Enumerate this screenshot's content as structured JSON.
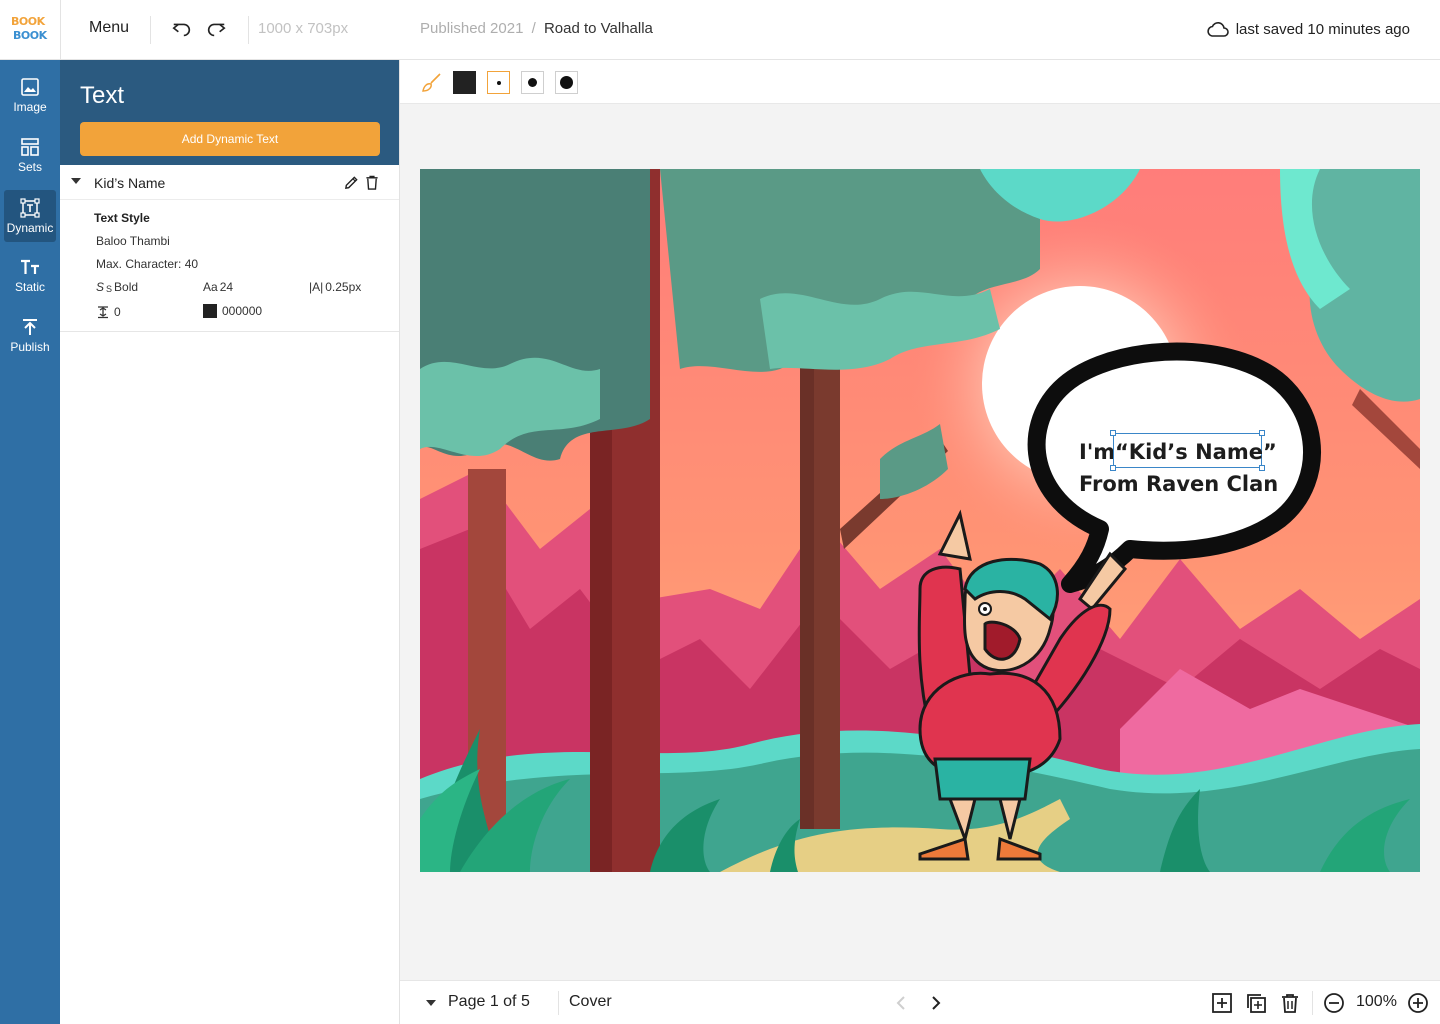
{
  "app": {
    "logo_top": "BOOK",
    "logo_bottom": "BOOK"
  },
  "topbar": {
    "menu_label": "Menu",
    "canvas_size": "1000 x 703px",
    "breadcrumb": {
      "parent": "Published 2021",
      "separator": "/",
      "current": "Road to Valhalla"
    },
    "save_status": "last saved 10 minutes ago"
  },
  "rail": {
    "items": [
      {
        "label": "Image",
        "icon": "image-icon"
      },
      {
        "label": "Sets",
        "icon": "sets-icon"
      },
      {
        "label": "Dynamic",
        "icon": "dynamic-text-icon",
        "active": true
      },
      {
        "label": "Static",
        "icon": "static-text-icon"
      },
      {
        "label": "Publish",
        "icon": "publish-icon"
      }
    ]
  },
  "panel": {
    "title": "Text",
    "add_button": "Add Dynamic Text",
    "item": {
      "name": "Kid’s Name",
      "style_title": "Text Style",
      "font": "Baloo Thambi",
      "max_chars": "Max. Character: 40",
      "weight": "Bold",
      "size": "24",
      "letter_spacing": "0.25px",
      "line_height": "0",
      "color_hex": "000000",
      "weight_icon": "S",
      "size_icon": "Aa",
      "spacing_icon": "|A|"
    }
  },
  "toolbar": {
    "tools": [
      "brush-icon",
      "color-swatch",
      "dot-small",
      "dot-medium",
      "dot-large"
    ],
    "color": "#222222"
  },
  "canvas": {
    "line1_prefix": "I'm",
    "line1_name": "“Kid’s Name”",
    "line2": "From Raven Clan"
  },
  "bottombar": {
    "page": "Page 1 of 5",
    "page_name": "Cover",
    "zoom": "100%"
  },
  "colors": {
    "accent": "#f2a33a",
    "rail": "#2f6fa5",
    "panel_header": "#2b5a80",
    "sky_top": "#ff8a7a",
    "sky_bottom": "#ffa978"
  }
}
